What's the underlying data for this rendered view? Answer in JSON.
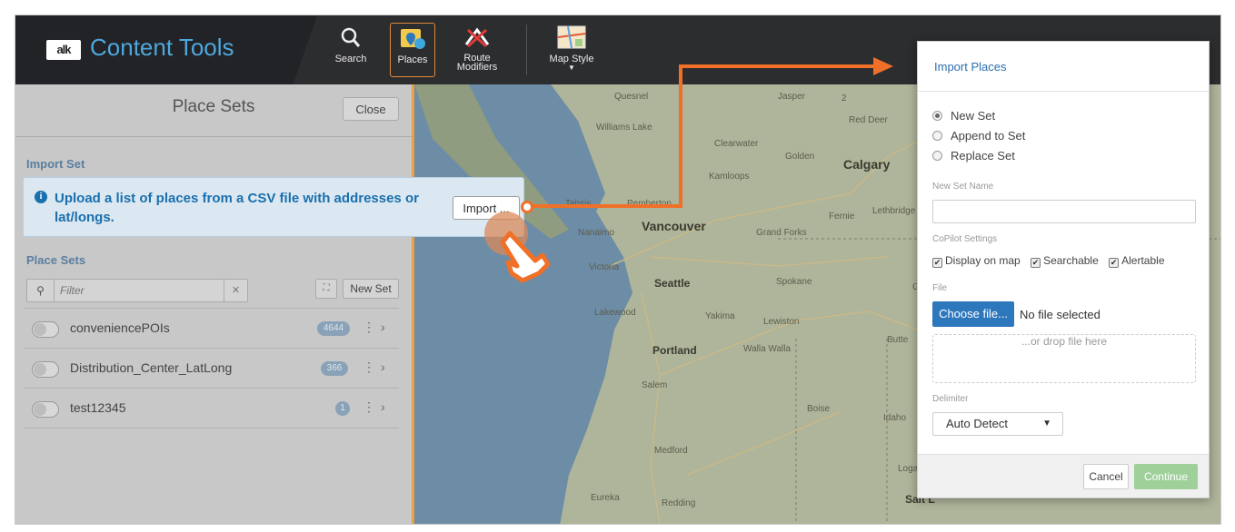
{
  "brand": {
    "logo_text": "alk",
    "title": "Content Tools"
  },
  "toolbar": {
    "search": "Search",
    "places": "Places",
    "route_modifiers_line1": "Route",
    "route_modifiers_line2": "Modifiers",
    "map_style": "Map Style"
  },
  "panel": {
    "title": "Place Sets",
    "close": "Close",
    "import_set_label": "Import Set",
    "place_sets_label": "Place Sets",
    "filter_placeholder": "Filter",
    "new_set": "New Set",
    "sets": [
      {
        "name": "conveniencePOIs",
        "count": "4644"
      },
      {
        "name": "Distribution_Center_LatLong",
        "count": "366"
      },
      {
        "name": "test12345",
        "count": "1"
      }
    ]
  },
  "callout": {
    "message": "Upload a list of places from a CSV file with addresses or lat/longs.",
    "import_button": "Import ..."
  },
  "map": {
    "labels": {
      "quesnel": "Quesnel",
      "jasper": "Jasper",
      "red_deer": "Red Deer",
      "williams_lake": "Williams Lake",
      "clearwater": "Clearwater",
      "golden": "Golden",
      "calgary": "Calgary",
      "kamloops": "Kamloops",
      "tahsis": "Tahsis",
      "pemberton": "Pemberton",
      "fernie": "Fernie",
      "lethbridge": "Lethbridge",
      "vancouver": "Vancouver",
      "nanaimo": "Nanaimo",
      "grand_forks": "Grand Forks",
      "victoria": "Victoria",
      "seattle": "Seattle",
      "spokane": "Spokane",
      "lakewood": "Lakewood",
      "yakima": "Yakima",
      "lewiston": "Lewiston",
      "portland": "Portland",
      "walla_walla": "Walla Walla",
      "butte": "Butte",
      "salem": "Salem",
      "boise": "Boise",
      "idaho": "Idaho",
      "medford": "Medford",
      "logan": "Logan",
      "eureka": "Eureka",
      "redding": "Redding",
      "salt_lake": "Salt L",
      "gre": "Gre",
      "highway_2": "2"
    }
  },
  "dialog": {
    "title": "Import Places",
    "options": [
      "New Set",
      "Append to Set",
      "Replace Set"
    ],
    "selected_option": "New Set",
    "new_set_name_label": "New Set Name",
    "new_set_name_value": "",
    "copilot_label": "CoPilot Settings",
    "copilot": [
      {
        "label": "Display on map",
        "checked": true
      },
      {
        "label": "Searchable",
        "checked": true
      },
      {
        "label": "Alertable",
        "checked": true
      }
    ],
    "file_label": "File",
    "choose_file": "Choose file...",
    "no_file": "No file selected",
    "drop_hint": "...or drop file here",
    "delimiter_label": "Delimiter",
    "delimiter_value": "Auto Detect",
    "cancel": "Cancel",
    "continue": "Continue"
  },
  "colors": {
    "accent_blue": "#2d77bd",
    "annotation_orange": "#f07028",
    "continue_green": "#9fd09a"
  }
}
